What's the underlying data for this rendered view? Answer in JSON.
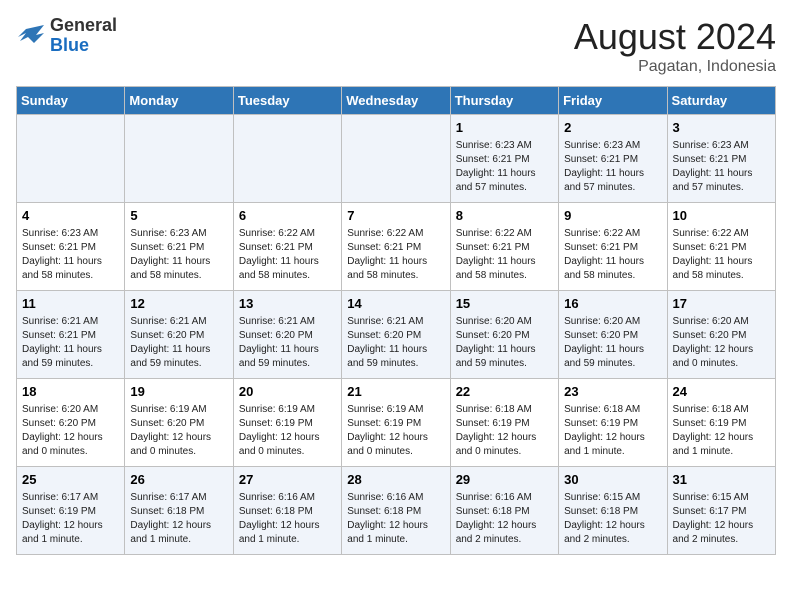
{
  "header": {
    "logo_general": "General",
    "logo_blue": "Blue",
    "main_title": "August 2024",
    "subtitle": "Pagatan, Indonesia"
  },
  "days_of_week": [
    "Sunday",
    "Monday",
    "Tuesday",
    "Wednesday",
    "Thursday",
    "Friday",
    "Saturday"
  ],
  "weeks": [
    [
      {
        "day": "",
        "info": ""
      },
      {
        "day": "",
        "info": ""
      },
      {
        "day": "",
        "info": ""
      },
      {
        "day": "",
        "info": ""
      },
      {
        "day": "1",
        "info": "Sunrise: 6:23 AM\nSunset: 6:21 PM\nDaylight: 11 hours and 57 minutes."
      },
      {
        "day": "2",
        "info": "Sunrise: 6:23 AM\nSunset: 6:21 PM\nDaylight: 11 hours and 57 minutes."
      },
      {
        "day": "3",
        "info": "Sunrise: 6:23 AM\nSunset: 6:21 PM\nDaylight: 11 hours and 57 minutes."
      }
    ],
    [
      {
        "day": "4",
        "info": "Sunrise: 6:23 AM\nSunset: 6:21 PM\nDaylight: 11 hours and 58 minutes."
      },
      {
        "day": "5",
        "info": "Sunrise: 6:23 AM\nSunset: 6:21 PM\nDaylight: 11 hours and 58 minutes."
      },
      {
        "day": "6",
        "info": "Sunrise: 6:22 AM\nSunset: 6:21 PM\nDaylight: 11 hours and 58 minutes."
      },
      {
        "day": "7",
        "info": "Sunrise: 6:22 AM\nSunset: 6:21 PM\nDaylight: 11 hours and 58 minutes."
      },
      {
        "day": "8",
        "info": "Sunrise: 6:22 AM\nSunset: 6:21 PM\nDaylight: 11 hours and 58 minutes."
      },
      {
        "day": "9",
        "info": "Sunrise: 6:22 AM\nSunset: 6:21 PM\nDaylight: 11 hours and 58 minutes."
      },
      {
        "day": "10",
        "info": "Sunrise: 6:22 AM\nSunset: 6:21 PM\nDaylight: 11 hours and 58 minutes."
      }
    ],
    [
      {
        "day": "11",
        "info": "Sunrise: 6:21 AM\nSunset: 6:21 PM\nDaylight: 11 hours and 59 minutes."
      },
      {
        "day": "12",
        "info": "Sunrise: 6:21 AM\nSunset: 6:20 PM\nDaylight: 11 hours and 59 minutes."
      },
      {
        "day": "13",
        "info": "Sunrise: 6:21 AM\nSunset: 6:20 PM\nDaylight: 11 hours and 59 minutes."
      },
      {
        "day": "14",
        "info": "Sunrise: 6:21 AM\nSunset: 6:20 PM\nDaylight: 11 hours and 59 minutes."
      },
      {
        "day": "15",
        "info": "Sunrise: 6:20 AM\nSunset: 6:20 PM\nDaylight: 11 hours and 59 minutes."
      },
      {
        "day": "16",
        "info": "Sunrise: 6:20 AM\nSunset: 6:20 PM\nDaylight: 11 hours and 59 minutes."
      },
      {
        "day": "17",
        "info": "Sunrise: 6:20 AM\nSunset: 6:20 PM\nDaylight: 12 hours and 0 minutes."
      }
    ],
    [
      {
        "day": "18",
        "info": "Sunrise: 6:20 AM\nSunset: 6:20 PM\nDaylight: 12 hours and 0 minutes."
      },
      {
        "day": "19",
        "info": "Sunrise: 6:19 AM\nSunset: 6:20 PM\nDaylight: 12 hours and 0 minutes."
      },
      {
        "day": "20",
        "info": "Sunrise: 6:19 AM\nSunset: 6:19 PM\nDaylight: 12 hours and 0 minutes."
      },
      {
        "day": "21",
        "info": "Sunrise: 6:19 AM\nSunset: 6:19 PM\nDaylight: 12 hours and 0 minutes."
      },
      {
        "day": "22",
        "info": "Sunrise: 6:18 AM\nSunset: 6:19 PM\nDaylight: 12 hours and 0 minutes."
      },
      {
        "day": "23",
        "info": "Sunrise: 6:18 AM\nSunset: 6:19 PM\nDaylight: 12 hours and 1 minute."
      },
      {
        "day": "24",
        "info": "Sunrise: 6:18 AM\nSunset: 6:19 PM\nDaylight: 12 hours and 1 minute."
      }
    ],
    [
      {
        "day": "25",
        "info": "Sunrise: 6:17 AM\nSunset: 6:19 PM\nDaylight: 12 hours and 1 minute."
      },
      {
        "day": "26",
        "info": "Sunrise: 6:17 AM\nSunset: 6:18 PM\nDaylight: 12 hours and 1 minute."
      },
      {
        "day": "27",
        "info": "Sunrise: 6:16 AM\nSunset: 6:18 PM\nDaylight: 12 hours and 1 minute."
      },
      {
        "day": "28",
        "info": "Sunrise: 6:16 AM\nSunset: 6:18 PM\nDaylight: 12 hours and 1 minute."
      },
      {
        "day": "29",
        "info": "Sunrise: 6:16 AM\nSunset: 6:18 PM\nDaylight: 12 hours and 2 minutes."
      },
      {
        "day": "30",
        "info": "Sunrise: 6:15 AM\nSunset: 6:18 PM\nDaylight: 12 hours and 2 minutes."
      },
      {
        "day": "31",
        "info": "Sunrise: 6:15 AM\nSunset: 6:17 PM\nDaylight: 12 hours and 2 minutes."
      }
    ]
  ]
}
